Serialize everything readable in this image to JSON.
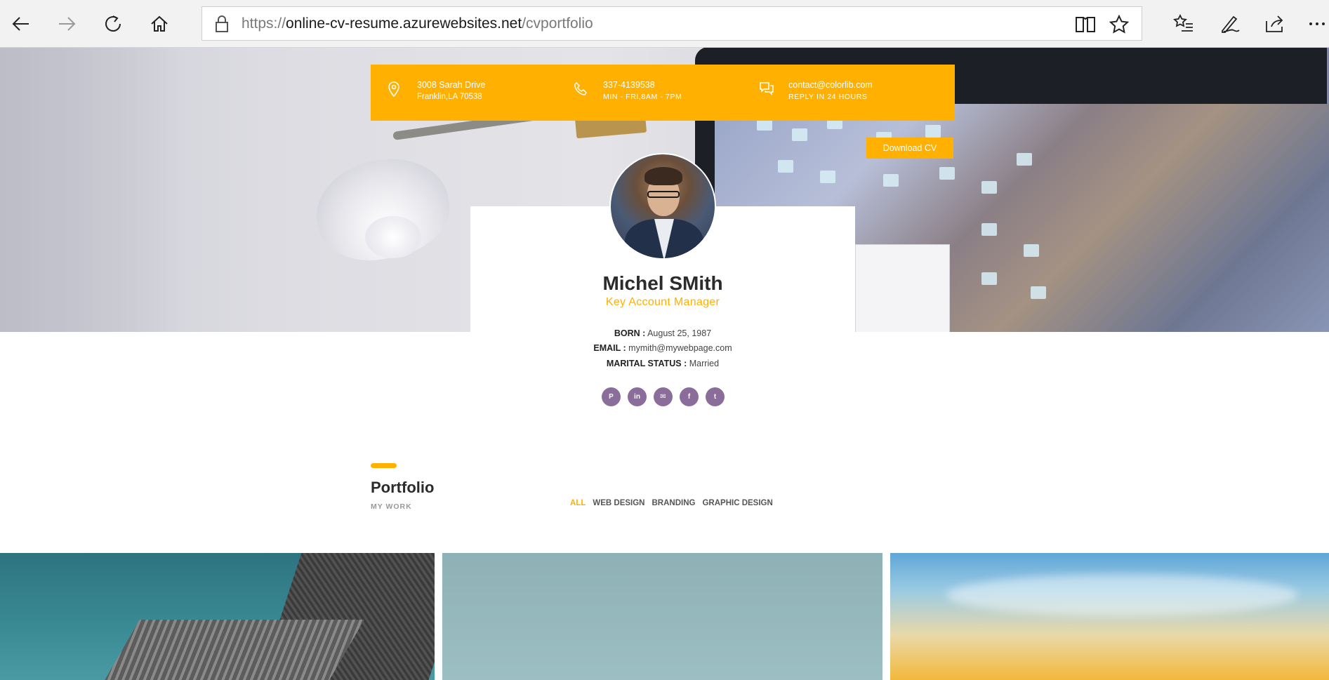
{
  "browser": {
    "url_scheme": "https://",
    "url_host": "online-cv-resume.azurewebsites.net",
    "url_path": "/cvportfolio"
  },
  "contact": {
    "address_line1": "3008 Sarah Drive",
    "address_line2": "Franklin,LA 70538",
    "phone_line1": "337-4139538",
    "phone_line2": "MIN - FRI,8AM - 7PM",
    "email_line1": "contact@colorlib.com",
    "email_line2": "REPLY IN 24 HOURS"
  },
  "download_label": "Download CV",
  "profile": {
    "name": "Michel SMith",
    "role": "Key Account Manager",
    "born_label": "BORN :",
    "born_value": "August 25, 1987",
    "email_label": "EMAIL :",
    "email_value": "mymith@mywebpage.com",
    "marital_label": "MARITAL STATUS :",
    "marital_value": "Married"
  },
  "socials": [
    {
      "name": "pinterest",
      "glyph": "P"
    },
    {
      "name": "linkedin",
      "glyph": "in"
    },
    {
      "name": "email",
      "glyph": "✉"
    },
    {
      "name": "facebook",
      "glyph": "f"
    },
    {
      "name": "twitter",
      "glyph": "t"
    }
  ],
  "portfolio": {
    "title": "Portfolio",
    "subtitle": "MY WORK",
    "filters": [
      "ALL",
      "WEB DESIGN",
      "BRANDING",
      "GRAPHIC DESIGN"
    ],
    "active_filter": "ALL"
  },
  "colors": {
    "accent": "#ffb000",
    "social": "#8a6d9a"
  }
}
